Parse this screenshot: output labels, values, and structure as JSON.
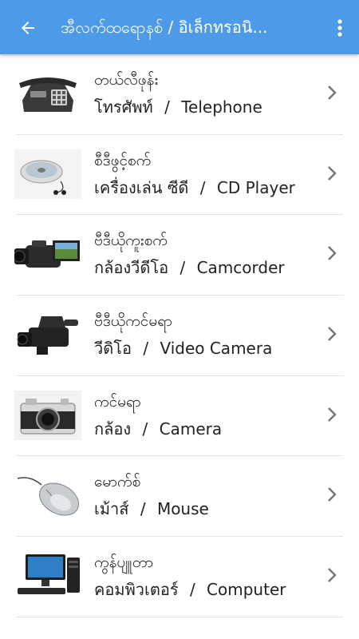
{
  "appbar": {
    "title": "အီလက်ထရောနစ် / อิเล็กทรอนิ...",
    "back_icon": "arrow-back-icon",
    "menu_icon": "more-vert-icon",
    "color": "#4d9ae8"
  },
  "items": [
    {
      "burmese": "တယ်လီဖုန်း",
      "thai": "โทรศัพท์",
      "sep": "/",
      "english": "Telephone",
      "icon": "telephone-icon"
    },
    {
      "burmese": "စီဒီဖွင့်စက်",
      "thai": "เครื่องเล่น ซีดี",
      "sep": "/",
      "english": "CD Player",
      "icon": "cd-player-icon"
    },
    {
      "burmese": "ဗီဒီယိုကူးစက်",
      "thai": "กล้องวีดีโอ",
      "sep": "/",
      "english": "Camcorder",
      "icon": "camcorder-icon"
    },
    {
      "burmese": "ဗီဒီယိုကင်မရာ",
      "thai": "วีดิโอ",
      "sep": "/",
      "english": "Video Camera",
      "icon": "video-camera-icon"
    },
    {
      "burmese": "ကင်မရာ",
      "thai": "กล้อง",
      "sep": "/",
      "english": "Camera",
      "icon": "camera-icon"
    },
    {
      "burmese": "မောက်စ်",
      "thai": "เม้าส์",
      "sep": "/",
      "english": "Mouse",
      "icon": "mouse-icon"
    },
    {
      "burmese": "ကွန်ပျူတာ",
      "thai": "คอมพิวเตอร์",
      "sep": "/",
      "english": "Computer",
      "icon": "computer-icon"
    }
  ]
}
